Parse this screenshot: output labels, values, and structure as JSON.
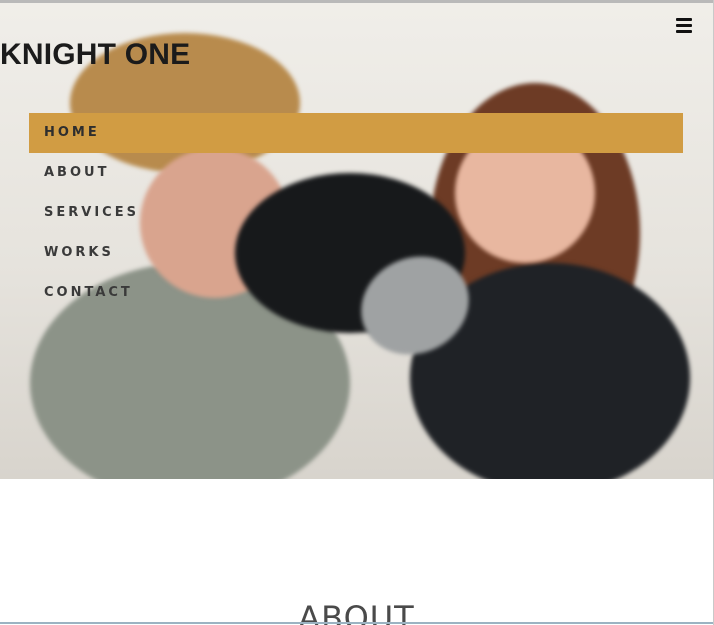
{
  "brand": {
    "name": "KNIGHT ONE"
  },
  "menu_toggle": {
    "icon": "hamburger-icon"
  },
  "nav": {
    "items": [
      {
        "label": "HOME",
        "active": true
      },
      {
        "label": "ABOUT",
        "active": false
      },
      {
        "label": "SERVICES",
        "active": false
      },
      {
        "label": "WORKS",
        "active": false
      },
      {
        "label": "CONTACT",
        "active": false
      }
    ]
  },
  "hero": {
    "image": "couple-boxing-glove-photo"
  },
  "sections": {
    "about_title": "ABOUT"
  },
  "colors": {
    "accent": "#d19c43",
    "text_dark": "#1b1b1b",
    "background": "#ffffff"
  }
}
